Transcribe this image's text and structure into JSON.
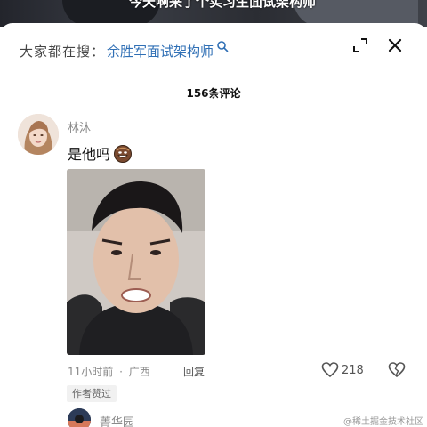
{
  "video": {
    "caption": "今天啊来了个实习生面试架构师"
  },
  "search": {
    "prefix": "大家都在搜：",
    "term": "余胜军面试架构师"
  },
  "comments_header": {
    "count_label": "156条评论"
  },
  "comment": {
    "author": "林沐",
    "text": "是他吗",
    "emoji": "laughing-face-emoji",
    "time": "11小时前",
    "separator": "·",
    "location": "广西",
    "reply_label": "回复",
    "like_count": "218",
    "badge": "作者赞过"
  },
  "next_comment": {
    "author": "菁华园"
  },
  "watermark": "@稀土掘金技术社区",
  "icons": {
    "expand": "expand-icon",
    "close": "close-icon",
    "search": "search-icon",
    "like": "heart-icon",
    "dislike": "broken-heart-icon"
  },
  "colors": {
    "search_link": "#2f6fb5",
    "meta_text": "#8a8a8a",
    "background": "#ffffff"
  }
}
